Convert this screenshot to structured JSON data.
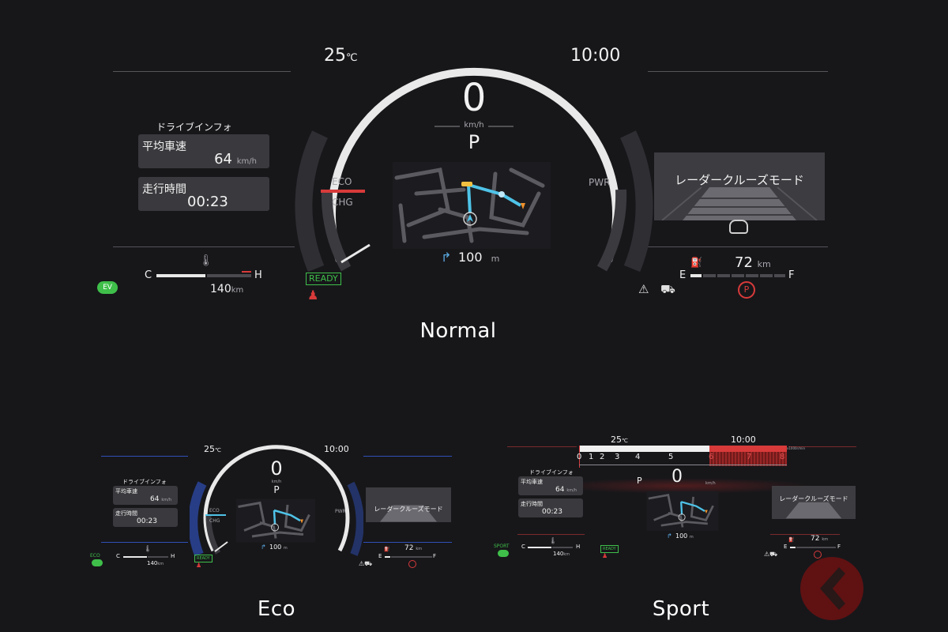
{
  "normal": {
    "caption": "Normal",
    "temperature": "25",
    "temperature_unit": "℃",
    "clock": "10:00",
    "speed": "0",
    "speed_unit": "km/h",
    "gear": "P",
    "drive_info": {
      "title": "ドライブインフォ",
      "avg_speed_label": "平均車速",
      "avg_speed_value": "64",
      "avg_speed_unit": "km/h",
      "drive_time_label": "走行時間",
      "drive_time_value": "00:23"
    },
    "power_labels": {
      "eco": "ECO",
      "chg": "CHG",
      "pwr": "PWR"
    },
    "ready": "READY",
    "nav_distance": "100",
    "nav_unit": "m",
    "cruise_mode": "レーダークルーズモード",
    "coolant": {
      "c": "C",
      "h": "H"
    },
    "ev_range": "140",
    "ev_range_unit": "km",
    "fuel": {
      "range": "72",
      "unit": "km",
      "e": "E",
      "f": "F"
    }
  },
  "eco": {
    "caption": "Eco",
    "temperature": "25",
    "temperature_unit": "℃",
    "clock": "10:00",
    "speed": "0",
    "speed_unit": "km/h",
    "gear": "P",
    "drive_info": {
      "title": "ドライブインフォ",
      "avg_speed_label": "平均車速",
      "avg_speed_value": "64",
      "avg_speed_unit": "km/h",
      "drive_time_label": "走行時間",
      "drive_time_value": "00:23"
    },
    "power_labels": {
      "eco": "ECO",
      "chg": "CHG",
      "pwr": "PWR"
    },
    "ready": "READY",
    "nav_distance": "100",
    "nav_unit": "m",
    "cruise_mode": "レーダークルーズモード",
    "coolant": {
      "c": "C",
      "h": "H"
    },
    "ev_badge": "ECO",
    "ev_range": "140",
    "ev_range_unit": "km",
    "fuel": {
      "range": "72",
      "unit": "km",
      "e": "E",
      "f": "F"
    }
  },
  "sport": {
    "caption": "Sport",
    "temperature": "25",
    "temperature_unit": "℃",
    "clock": "10:00",
    "speed": "0",
    "speed_unit": "km/h",
    "gear": "P",
    "tach_labels": [
      "0",
      "1",
      "2",
      "3",
      "4",
      "5",
      "6",
      "7",
      "8"
    ],
    "tach_unit": "x1000r/min",
    "drive_info": {
      "title": "ドライブインフォ",
      "avg_speed_label": "平均車速",
      "avg_speed_value": "64",
      "avg_speed_unit": "km/h",
      "drive_time_label": "走行時間",
      "drive_time_value": "00:23"
    },
    "ready": "READY",
    "nav_distance": "100",
    "nav_unit": "m",
    "cruise_mode": "レーダークルーズモード",
    "coolant": {
      "c": "C",
      "h": "H"
    },
    "ev_badge": "SPORT",
    "ev_range": "140",
    "ev_range_unit": "km",
    "fuel": {
      "range": "72",
      "unit": "km",
      "e": "E",
      "f": "F"
    }
  },
  "colors": {
    "arc": "#e9e9e9",
    "route": "#4fc3e8",
    "red": "#d83a3a",
    "green": "#3fbf4a",
    "eco_blue": "#2f4fb5"
  }
}
